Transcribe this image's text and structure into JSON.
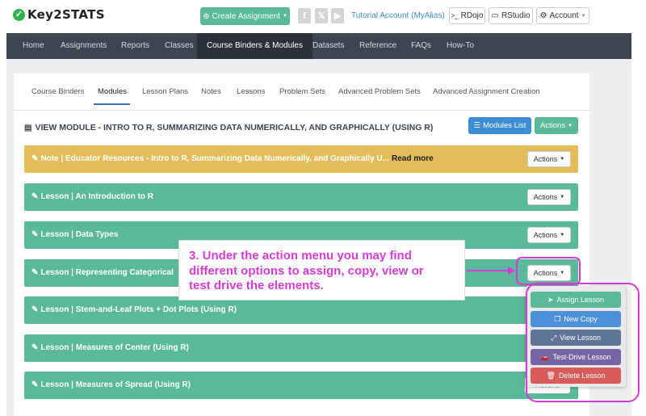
{
  "brand": {
    "name": "Key2STATS"
  },
  "topbar": {
    "create_label": "Create Assignment",
    "tutorial_label": "Tutorial Account (MyAlias)",
    "rdojo_label": "RDojo",
    "rstudio_label": "RStudio",
    "account_label": "Account"
  },
  "nav": [
    "Home",
    "Assignments",
    "Reports",
    "Classes",
    "Course Binders & Modules",
    "Datasets",
    "Reference",
    "FAQs",
    "How-To"
  ],
  "tabs": [
    "Course Binders",
    "Modules",
    "Lesson Plans",
    "Notes",
    "Lessons",
    "Problem Sets",
    "Advanced Problem Sets",
    "Advanced Assignment Creation"
  ],
  "page": {
    "title": "VIEW MODULE - INTRO TO R, SUMMARIZING DATA NUMERICALLY, AND GRAPHICALLY (USING R)",
    "modules_list_label": "Modules List",
    "actions_label": "Actions"
  },
  "rows": [
    {
      "label": "Note | Educator Resources - Intro to R, Summarizing Data Numerically, and Graphically U...",
      "read_more": "Read more"
    },
    {
      "label": "Lesson | An Introduction to R"
    },
    {
      "label": "Lesson | Data Types"
    },
    {
      "label": "Lesson | Representing Categorical"
    },
    {
      "label": "Lesson | Stem-and-Leaf Plots + Dot Plots (Using R)"
    },
    {
      "label": "Lesson | Measures of Center (Using R)"
    },
    {
      "label": "Lesson | Measures of Spread (Using R)"
    }
  ],
  "row_actions_label": "Actions",
  "callout": {
    "line1": "3. Under the action menu you may find",
    "line2": "different options to assign, copy, view or",
    "line3": "test drive the elements."
  },
  "dropdown": [
    "Assign Lesson",
    "New Copy",
    "View Lesson",
    "Test-Drive Lesson",
    "Delete Lesson"
  ],
  "colors": {
    "green": "#59b99a",
    "blue": "#3d8dd6",
    "yellow": "#e2bd5a",
    "nav": "#3d4550",
    "callout": "#d83ad8",
    "dd_blue": "#4b90d8",
    "dd_slate": "#5f7597",
    "dd_purple": "#7466a6",
    "dd_red": "#d75b59"
  }
}
